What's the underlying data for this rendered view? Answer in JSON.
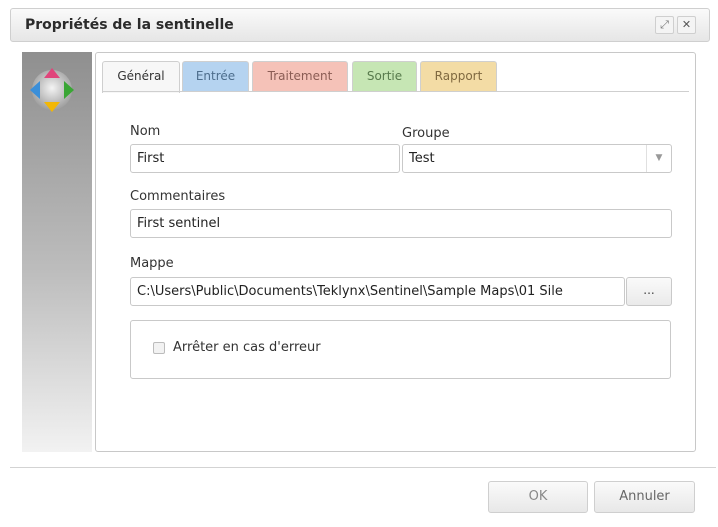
{
  "dialog": {
    "title": "Propriétés de la sentinelle",
    "maximize_icon": "⤢",
    "close_icon": "✕"
  },
  "tabs": [
    {
      "label": "Général",
      "color": "#f7f7f7"
    },
    {
      "label": "Entrée",
      "color": "#b5d3f0"
    },
    {
      "label": "Traitement",
      "color": "#f5c2b8"
    },
    {
      "label": "Sortie",
      "color": "#c6e6b4"
    },
    {
      "label": "Rapport",
      "color": "#f3dca5"
    }
  ],
  "form": {
    "nom_label": "Nom",
    "nom_value": "First",
    "groupe_label": "Groupe",
    "groupe_value": "Test",
    "commentaires_label": "Commentaires",
    "commentaires_value": "First sentinel",
    "mappe_label": "Mappe",
    "mappe_value": "C:\\Users\\Public\\Documents\\Teklynx\\Sentinel\\Sample Maps\\01 Sile",
    "browse_label": "...",
    "stop_on_error_label": "Arrêter en cas d'erreur",
    "stop_on_error_checked": false
  },
  "buttons": {
    "ok": "OK",
    "cancel": "Annuler"
  }
}
